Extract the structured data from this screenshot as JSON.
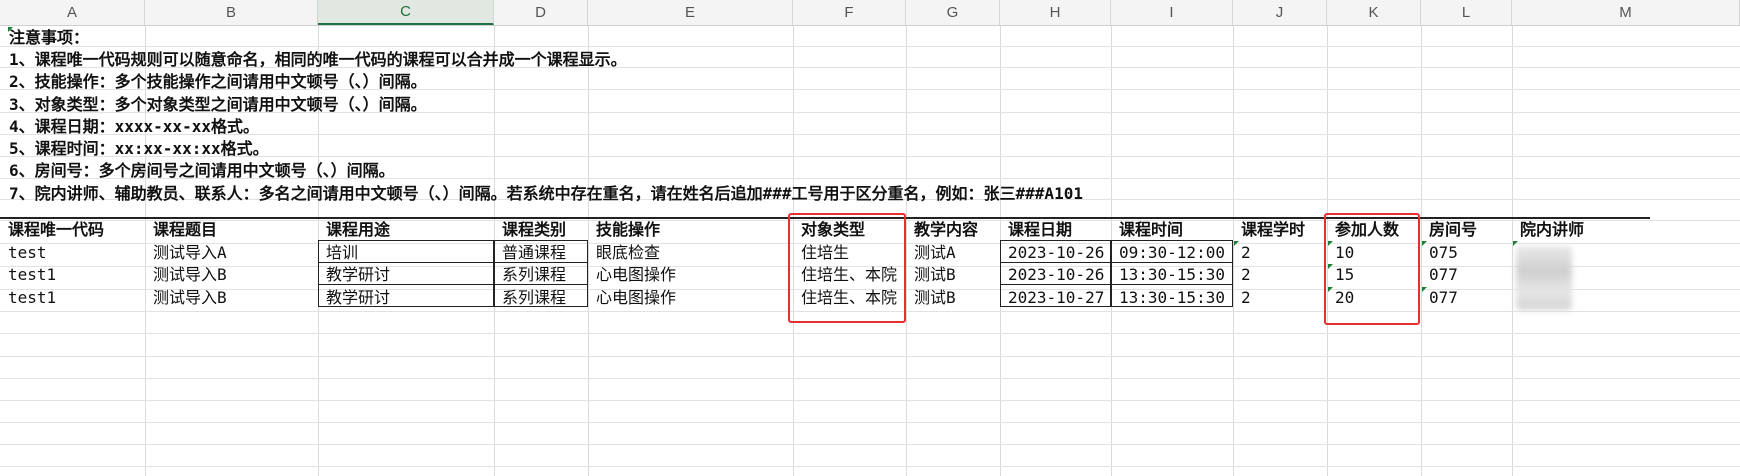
{
  "columns": [
    "A",
    "B",
    "C",
    "D",
    "E",
    "F",
    "G",
    "H",
    "I",
    "J",
    "K",
    "L",
    "M"
  ],
  "selected_column": "C",
  "notes": [
    "注意事项：",
    "1、课程唯一代码规则可以随意命名，相同的唯一代码的课程可以合并成一个课程显示。",
    "2、技能操作：多个技能操作之间请用中文顿号（、）间隔。",
    "3、对象类型：多个对象类型之间请用中文顿号（、）间隔。",
    "4、课程日期：xxxx-xx-xx格式。",
    "5、课程时间：xx:xx-xx:xx格式。",
    "6、房间号：多个房间号之间请用中文顿号（、）间隔。",
    "7、院内讲师、辅助教员、联系人：多名之间请用中文顿号（、）间隔。若系统中存在重名，请在姓名后追加###工号用于区分重名，例如：张三###A101"
  ],
  "table": {
    "headers": [
      "课程唯一代码",
      "课程题目",
      "课程用途",
      "课程类别",
      "技能操作",
      "对象类型",
      "教学内容",
      "课程日期",
      "课程时间",
      "课程学时",
      "参加人数",
      "房间号",
      "院内讲师"
    ],
    "rows": [
      [
        "test",
        "测试导入A",
        "培训",
        "普通课程",
        "眼底检查",
        "住培生",
        "测试A",
        "2023-10-26",
        "09:30-12:00",
        "2",
        "10",
        "075",
        ""
      ],
      [
        "test1",
        "测试导入B",
        "教学研讨",
        "系列课程",
        "心电图操作",
        "住培生、本院",
        "测试B",
        "2023-10-26",
        "13:30-15:30",
        "2",
        "15",
        "077",
        ""
      ],
      [
        "test1",
        "测试导入B",
        "教学研讨",
        "系列课程",
        "心电图操作",
        "住培生、本院",
        "测试B",
        "2023-10-27",
        "13:30-15:30",
        "2",
        "20",
        "077",
        ""
      ]
    ]
  },
  "highlight_color": "#e53030"
}
